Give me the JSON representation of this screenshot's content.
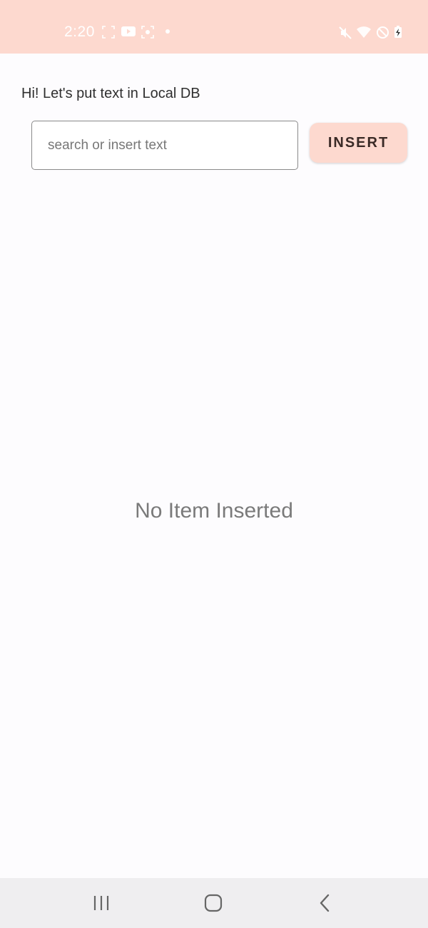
{
  "status_bar": {
    "time": "2:20",
    "icons": [
      "screenshot-icon",
      "youtube-icon",
      "scan-icon",
      "dot-icon",
      "mute-icon",
      "wifi-icon",
      "do-not-disturb-icon",
      "battery-charging-icon"
    ]
  },
  "main": {
    "greeting": "Hi! Let's put text in Local DB",
    "search": {
      "placeholder": "search or insert text",
      "value": ""
    },
    "insert_button_label": "INSERT",
    "empty_message": "No Item Inserted"
  },
  "nav_bar": {
    "buttons": [
      "recent-apps-icon",
      "home-icon",
      "back-icon"
    ]
  },
  "colors": {
    "accent": "#fdd9cf",
    "background": "#fdfcfe",
    "nav_background": "#efeef0"
  }
}
